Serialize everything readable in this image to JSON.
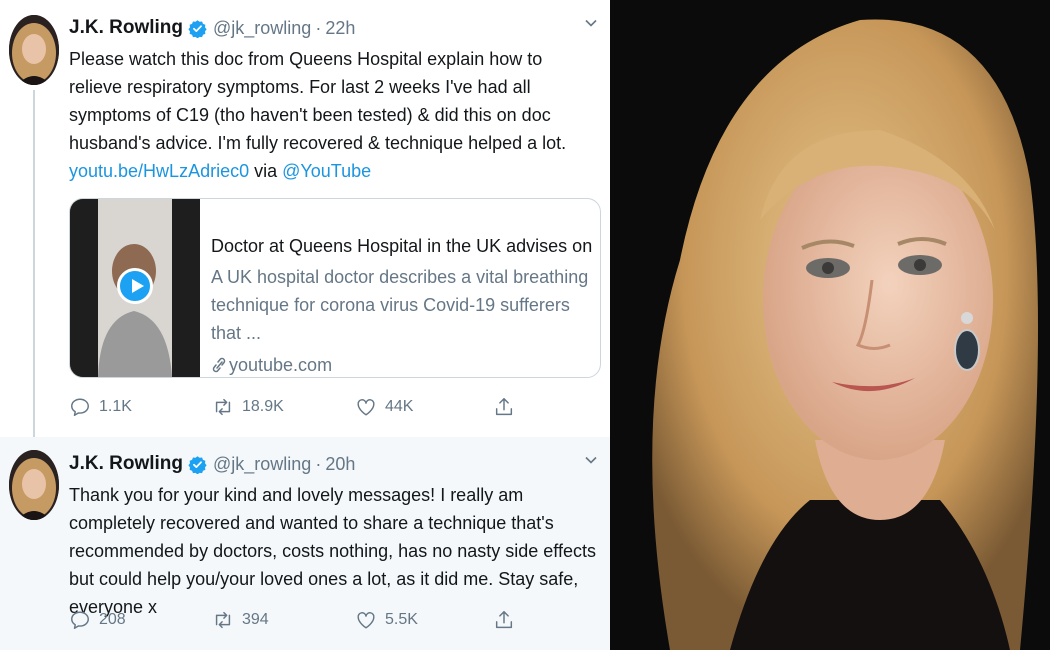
{
  "tweets": [
    {
      "name": "J.K. Rowling",
      "handle": "@jk_rowling",
      "separator": "·",
      "time": "22h",
      "text": "Please watch this doc from Queens Hospital explain how to relieve respiratory symptoms. For last 2 weeks I've had all symptoms of C19 (tho haven't been tested) & did this on doc husband's advice. I'm fully recovered & technique helped a lot.",
      "link": "youtu.be/HwLzAdriec0",
      "via": "via",
      "mention": "@YouTube",
      "card": {
        "title": "Doctor at Queens Hospital in the UK advises on pote...",
        "description": "A UK hospital doctor describes a vital breathing technique for corona virus Covid-19 sufferers that ...",
        "domain": "youtube.com"
      },
      "replies": "1.1K",
      "retweets": "18.9K",
      "likes": "44K"
    },
    {
      "name": "J.K. Rowling",
      "handle": "@jk_rowling",
      "separator": "·",
      "time": "20h",
      "text": "Thank you for your kind and lovely messages! I really am completely recovered and wanted to share a technique that's recommended by doctors, costs nothing, has no nasty side effects but could help you/your loved ones a lot, as it did me. Stay safe, everyone x",
      "replies": "208",
      "retweets": "394",
      "likes": "5.5K"
    }
  ],
  "colors": {
    "link": "#1b95e0",
    "verified": "#1da1f2",
    "muted": "#657786",
    "highlight_bg": "#f5f8fa"
  },
  "icons": [
    "verified-badge-icon",
    "chevron-down-icon",
    "reply-icon",
    "retweet-icon",
    "like-icon",
    "share-icon",
    "link-icon",
    "play-icon"
  ]
}
